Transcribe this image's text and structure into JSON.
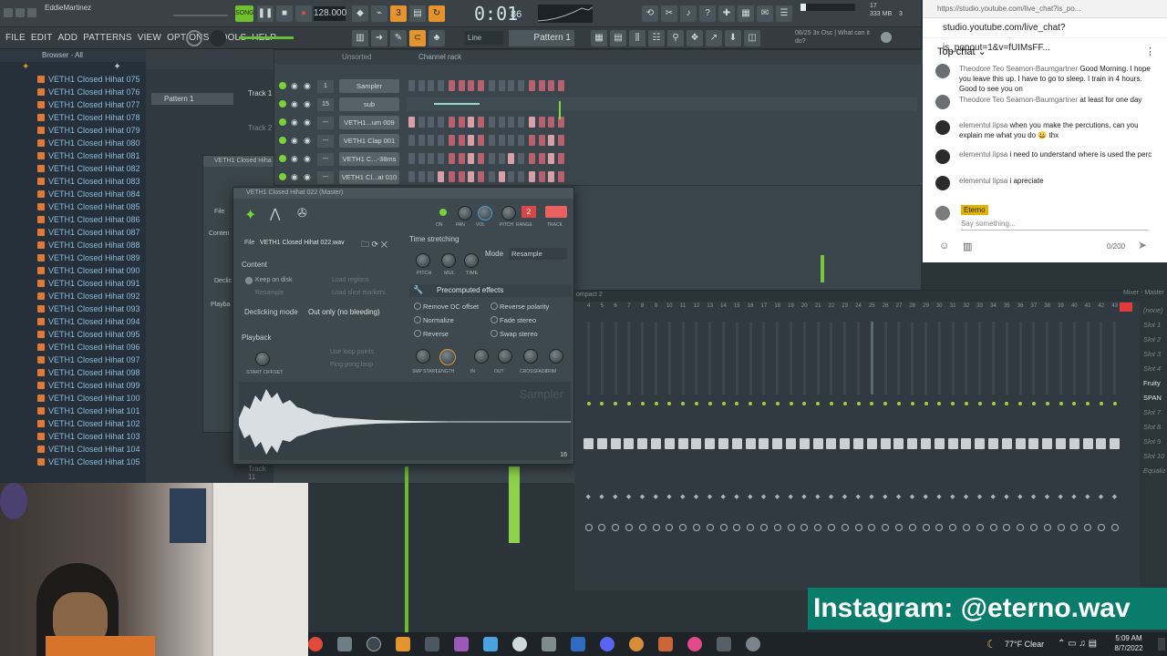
{
  "titlebar": {
    "user": "EddieMartinez",
    "tempo": "128.000",
    "time": "0:01",
    "time_sub": "86",
    "pattern": "Pattern 1",
    "snap": "Line",
    "hint": "06/25 3x Osc | What can it do?",
    "cpu": "17",
    "mem": "333 MB",
    "voices": "3"
  },
  "menu": [
    "FILE",
    "EDIT",
    "ADD",
    "PATTERNS",
    "VIEW",
    "OPTIONS",
    "TOOLS",
    "HELP"
  ],
  "browser": {
    "title": "Browser - All",
    "items": [
      "VETH1 Closed Hihat 075",
      "VETH1 Closed Hihat 076",
      "VETH1 Closed Hihat 077",
      "VETH1 Closed Hihat 078",
      "VETH1 Closed Hihat 079",
      "VETH1 Closed Hihat 080",
      "VETH1 Closed Hihat 081",
      "VETH1 Closed Hihat 082",
      "VETH1 Closed Hihat 083",
      "VETH1 Closed Hihat 084",
      "VETH1 Closed Hihat 085",
      "VETH1 Closed Hihat 086",
      "VETH1 Closed Hihat 087",
      "VETH1 Closed Hihat 088",
      "VETH1 Closed Hihat 089",
      "VETH1 Closed Hihat 090",
      "VETH1 Closed Hihat 091",
      "VETH1 Closed Hihat 092",
      "VETH1 Closed Hihat 093",
      "VETH1 Closed Hihat 094",
      "VETH1 Closed Hihat 095",
      "VETH1 Closed Hihat 096",
      "VETH1 Closed Hihat 097",
      "VETH1 Closed Hihat 098",
      "VETH1 Closed Hihat 099",
      "VETH1 Closed Hihat 100",
      "VETH1 Closed Hihat 101",
      "VETH1 Closed Hihat 102",
      "VETH1 Closed Hihat 103",
      "VETH1 Closed Hihat 104",
      "VETH1 Closed Hihat 105"
    ]
  },
  "playlist": {
    "pattern": "Pattern 1",
    "track1": "Track 1",
    "track2": "Track 2",
    "track_bottom": "Track 11"
  },
  "channelrack": {
    "title": "Channel rack",
    "filter": "Unsorted",
    "channels": [
      {
        "num": "1",
        "name": "Sampler"
      },
      {
        "num": "15",
        "name": "sub"
      },
      {
        "num": "---",
        "name": "VETH1...um 009"
      },
      {
        "num": "---",
        "name": "VETH1 Clap 001"
      },
      {
        "num": "---",
        "name": "VETH1 C...-38ms"
      },
      {
        "num": "---",
        "name": "VETH1 Cl...at 010"
      }
    ]
  },
  "sampler": {
    "title": "VETH1 Closed Hihat 022 (Master)",
    "file_label": "File",
    "file_name": "VETH1 Closed Hihat 022.wav",
    "content": "Content",
    "keep_on_disk": "Keep on disk",
    "resample": "Resample",
    "load_regions": "Load regions",
    "load_slice": "Load slice markers",
    "declicking": "Declicking mode",
    "declick_value": "Out only (no bleeding)",
    "playback": "Playback",
    "use_loop": "Use loop points",
    "ping_pong": "Ping-pong loop",
    "start_offset": "START OFFSET",
    "time_stretching": "Time stretching",
    "mode": "Mode",
    "mode_value": "Resample",
    "knobs_ts": [
      "PITCH",
      "MUL",
      "TIME"
    ],
    "precomputed": "Precomputed effects",
    "effects_left": [
      "Remove DC offset",
      "Normalize",
      "Reverse"
    ],
    "effects_right": [
      "Reverse polarity",
      "Fade stereo",
      "Swap stereo"
    ],
    "knobs_fx": [
      "SMP START",
      "LENGTH",
      "IN",
      "OUT",
      "CROSSFADE",
      "TRIM"
    ],
    "top_knobs": [
      "ON",
      "PAN",
      "VOL",
      "PITCH",
      "RANGE",
      "TRACK"
    ],
    "range": "2",
    "watermark": "Sampler",
    "bits": "16"
  },
  "bg_window": {
    "title": "VETH1 Closed Hiha",
    "file": "File",
    "content": "Conten",
    "declic": "Declic",
    "playb": "Playba"
  },
  "mixer": {
    "title": "Mixer - Master",
    "compact": "ompact 2",
    "right_items": [
      "(none)",
      "Slot 1",
      "Slot 2",
      "Slot 3",
      "Slot 4",
      "Fruity",
      "SPAN",
      "Slot 7",
      "Slot 8",
      "Slot 9",
      "Slot 10",
      "Equaliz"
    ]
  },
  "chat": {
    "url": "https://studio.youtube.com/live_chat?is_po...",
    "addr": "studio.youtube.com/live_chat?is_popout=1&v=fUIMsFF...",
    "title": "Top chat",
    "messages": [
      {
        "author": "Theodore Teo Seamon-Baumgartner",
        "text": "Good Morning. I hope you leave this up. I have to go to sleep. I train in 4 hours. Good to see you on"
      },
      {
        "author": "Theodore Teo Seamon-Baumgartner",
        "text": "at least for one day"
      },
      {
        "author": "elementul lipsa",
        "text": "when you make the percutions, can you explain me what you do 😀 thx"
      },
      {
        "author": "elementul lipsa",
        "text": "i need to understand where is used the perc"
      },
      {
        "author": "elementul lipsa",
        "text": "i apreciate"
      }
    ],
    "me": "Eterno",
    "placeholder": "Say something...",
    "counter": "0/200"
  },
  "overlay": {
    "instagram": "Instagram: @eterno.wav"
  },
  "taskbar": {
    "weather": "77°F  Clear",
    "time": "5:09 AM",
    "date": "8/7/2022"
  },
  "colors": {
    "accent": "#e3942c",
    "green": "#6fbf2f",
    "overlay": "#0a7c6b"
  }
}
